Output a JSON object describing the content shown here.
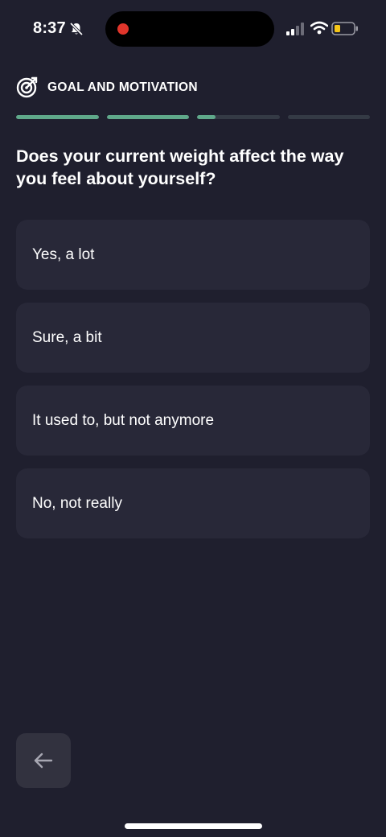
{
  "status_bar": {
    "time": "8:37",
    "bell_icon": "bell-slash-icon",
    "signal_icon": "cellular-signal-icon",
    "wifi_icon": "wifi-icon",
    "battery_icon": "battery-low-icon",
    "battery_color": "#f5c518",
    "recording_color": "#e0352b"
  },
  "header": {
    "icon": "target-icon",
    "title": "GOAL AND MOTIVATION",
    "progress": [
      1,
      1,
      0.22,
      0
    ],
    "accent": "#5fa88a"
  },
  "question": "Does your current weight affect the way you feel about yourself?",
  "options": [
    {
      "label": "Yes, a lot"
    },
    {
      "label": "Sure, a bit"
    },
    {
      "label": "It used to, but not anymore"
    },
    {
      "label": "No, not really"
    }
  ],
  "back_button": {
    "icon": "arrow-left-icon"
  }
}
